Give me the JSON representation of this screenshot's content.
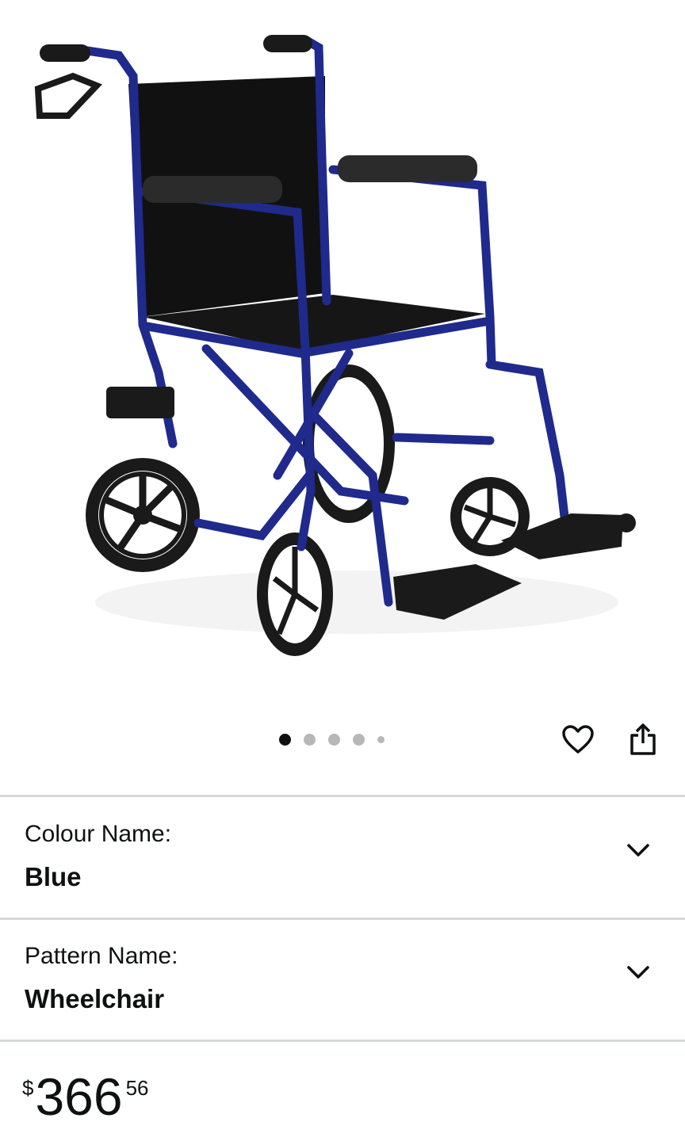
{
  "product": {
    "image_alt": "Blue transport wheelchair with black seat and hand brakes",
    "carousel": {
      "total_images": 5,
      "active_index": 0
    },
    "actions": {
      "wishlist_icon": "heart-icon",
      "share_icon": "share-icon"
    }
  },
  "variations": [
    {
      "label": "Colour Name:",
      "value": "Blue"
    },
    {
      "label": "Pattern Name:",
      "value": "Wheelchair"
    }
  ],
  "price": {
    "symbol": "$",
    "whole": "366",
    "fraction": "56"
  },
  "colors": {
    "frame": "#1f2a8c",
    "divider": "#d5d9d9",
    "text": "#0f1111"
  }
}
